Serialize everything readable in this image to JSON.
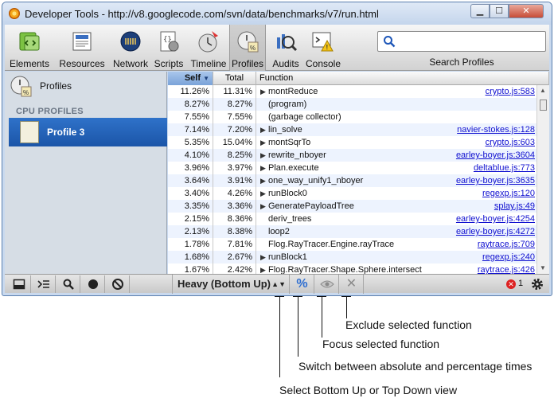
{
  "window": {
    "title": "Developer Tools - http://v8.googlecode.com/svn/data/benchmarks/v7/run.html",
    "minimize": "▁",
    "maximize": "☐",
    "close": "✕"
  },
  "toolbar": {
    "items": [
      {
        "label": "Elements",
        "icon": "elements-icon"
      },
      {
        "label": "Resources",
        "icon": "resources-icon"
      },
      {
        "label": "Network",
        "icon": "network-icon"
      },
      {
        "label": "Scripts",
        "icon": "scripts-icon"
      },
      {
        "label": "Timeline",
        "icon": "timeline-icon"
      },
      {
        "label": "Profiles",
        "icon": "profiles-icon"
      },
      {
        "label": "Audits",
        "icon": "audits-icon"
      },
      {
        "label": "Console",
        "icon": "console-icon"
      }
    ],
    "active": "Profiles",
    "search_value": "",
    "search_label": "Search Profiles"
  },
  "sidebar": {
    "profiles_label": "Profiles",
    "section_header": "CPU PROFILES",
    "selected_item": "Profile 3"
  },
  "grid": {
    "columns": {
      "self": "Self",
      "sort_indicator": "▼",
      "total": "Total",
      "function": "Function"
    },
    "rows": [
      {
        "self": "11.26%",
        "total": "11.31%",
        "expandable": true,
        "function": "montReduce",
        "link": "crypto.js:583"
      },
      {
        "self": "8.27%",
        "total": "8.27%",
        "expandable": false,
        "function": "(program)",
        "link": ""
      },
      {
        "self": "7.55%",
        "total": "7.55%",
        "expandable": false,
        "function": "(garbage collector)",
        "link": ""
      },
      {
        "self": "7.14%",
        "total": "7.20%",
        "expandable": true,
        "function": "lin_solve",
        "link": "navier-stokes.js:128"
      },
      {
        "self": "5.35%",
        "total": "15.04%",
        "expandable": true,
        "function": "montSqrTo",
        "link": "crypto.js:603"
      },
      {
        "self": "4.10%",
        "total": "8.25%",
        "expandable": true,
        "function": "rewrite_nboyer",
        "link": "earley-boyer.js:3604"
      },
      {
        "self": "3.96%",
        "total": "3.97%",
        "expandable": true,
        "function": "Plan.execute",
        "link": "deltablue.js:773"
      },
      {
        "self": "3.64%",
        "total": "3.91%",
        "expandable": true,
        "function": "one_way_unify1_nboyer",
        "link": "earley-boyer.js:3635"
      },
      {
        "self": "3.40%",
        "total": "4.26%",
        "expandable": true,
        "function": "runBlock0",
        "link": "regexp.js:120"
      },
      {
        "self": "3.35%",
        "total": "3.36%",
        "expandable": true,
        "function": "GeneratePayloadTree",
        "link": "splay.js:49"
      },
      {
        "self": "2.15%",
        "total": "8.36%",
        "expandable": false,
        "function": "deriv_trees",
        "link": "earley-boyer.js:4254"
      },
      {
        "self": "2.13%",
        "total": "8.38%",
        "expandable": false,
        "function": "loop2",
        "link": "earley-boyer.js:4272"
      },
      {
        "self": "1.78%",
        "total": "7.81%",
        "expandable": false,
        "function": "Flog.RayTracer.Engine.rayTrace",
        "link": "raytrace.js:709"
      },
      {
        "self": "1.68%",
        "total": "2.67%",
        "expandable": true,
        "function": "runBlock1",
        "link": "regexp.js:240"
      },
      {
        "self": "1.67%",
        "total": "2.42%",
        "expandable": true,
        "function": "Flog.RayTracer.Shape.Sphere.intersect",
        "link": "raytrace.js:426"
      }
    ]
  },
  "statusbar": {
    "view_select": "Heavy (Bottom Up)",
    "view_select_arrow": "▲▼",
    "percent_toggle": "%",
    "exclude_button": "✕",
    "error_icon": "✕",
    "error_count": "1"
  },
  "callouts": {
    "exclude": "Exclude selected function",
    "focus": "Focus selected function",
    "percent": "Switch between absolute and percentage times",
    "view": "Select Bottom Up or Top Down view"
  }
}
